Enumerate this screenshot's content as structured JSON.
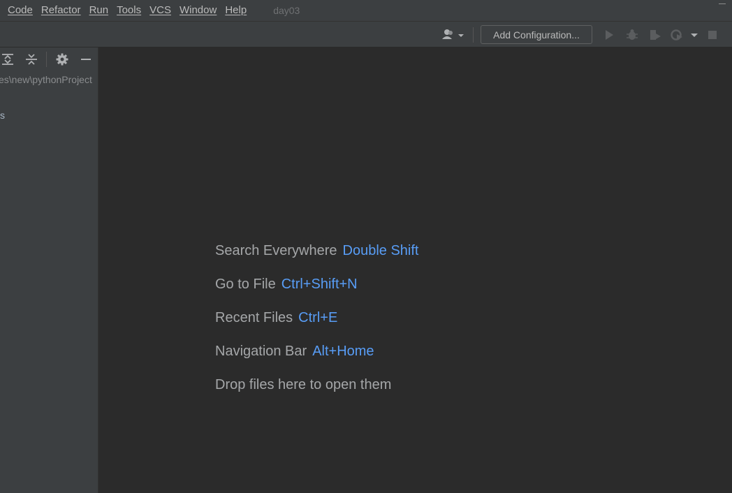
{
  "menubar": {
    "items": [
      "Code",
      "Refactor",
      "Run",
      "Tools",
      "VCS",
      "Window",
      "Help"
    ],
    "project_title": "day03"
  },
  "toolbar": {
    "add_configuration_label": "Add Configuration...",
    "icons": [
      "user-icon",
      "run-icon",
      "debug-icon",
      "coverage-icon",
      "profile-icon",
      "stop-icon"
    ]
  },
  "sidebar": {
    "path_text": "es\\new\\pythonProject",
    "tree_text": "s",
    "icons": [
      "expand-all-icon",
      "collapse-all-icon",
      "gear-icon",
      "hide-icon"
    ]
  },
  "editor": {
    "hints": [
      {
        "label": "Search Everywhere",
        "shortcut": "Double Shift"
      },
      {
        "label": "Go to File",
        "shortcut": "Ctrl+Shift+N"
      },
      {
        "label": "Recent Files",
        "shortcut": "Ctrl+E"
      },
      {
        "label": "Navigation Bar",
        "shortcut": "Alt+Home"
      }
    ],
    "drop_text": "Drop files here to open them"
  },
  "colors": {
    "menubar_bg": "#3c3f41",
    "editor_bg": "#2b2b2b",
    "shortcut_blue": "#589df6",
    "hint_gray": "#a5a7a9"
  }
}
